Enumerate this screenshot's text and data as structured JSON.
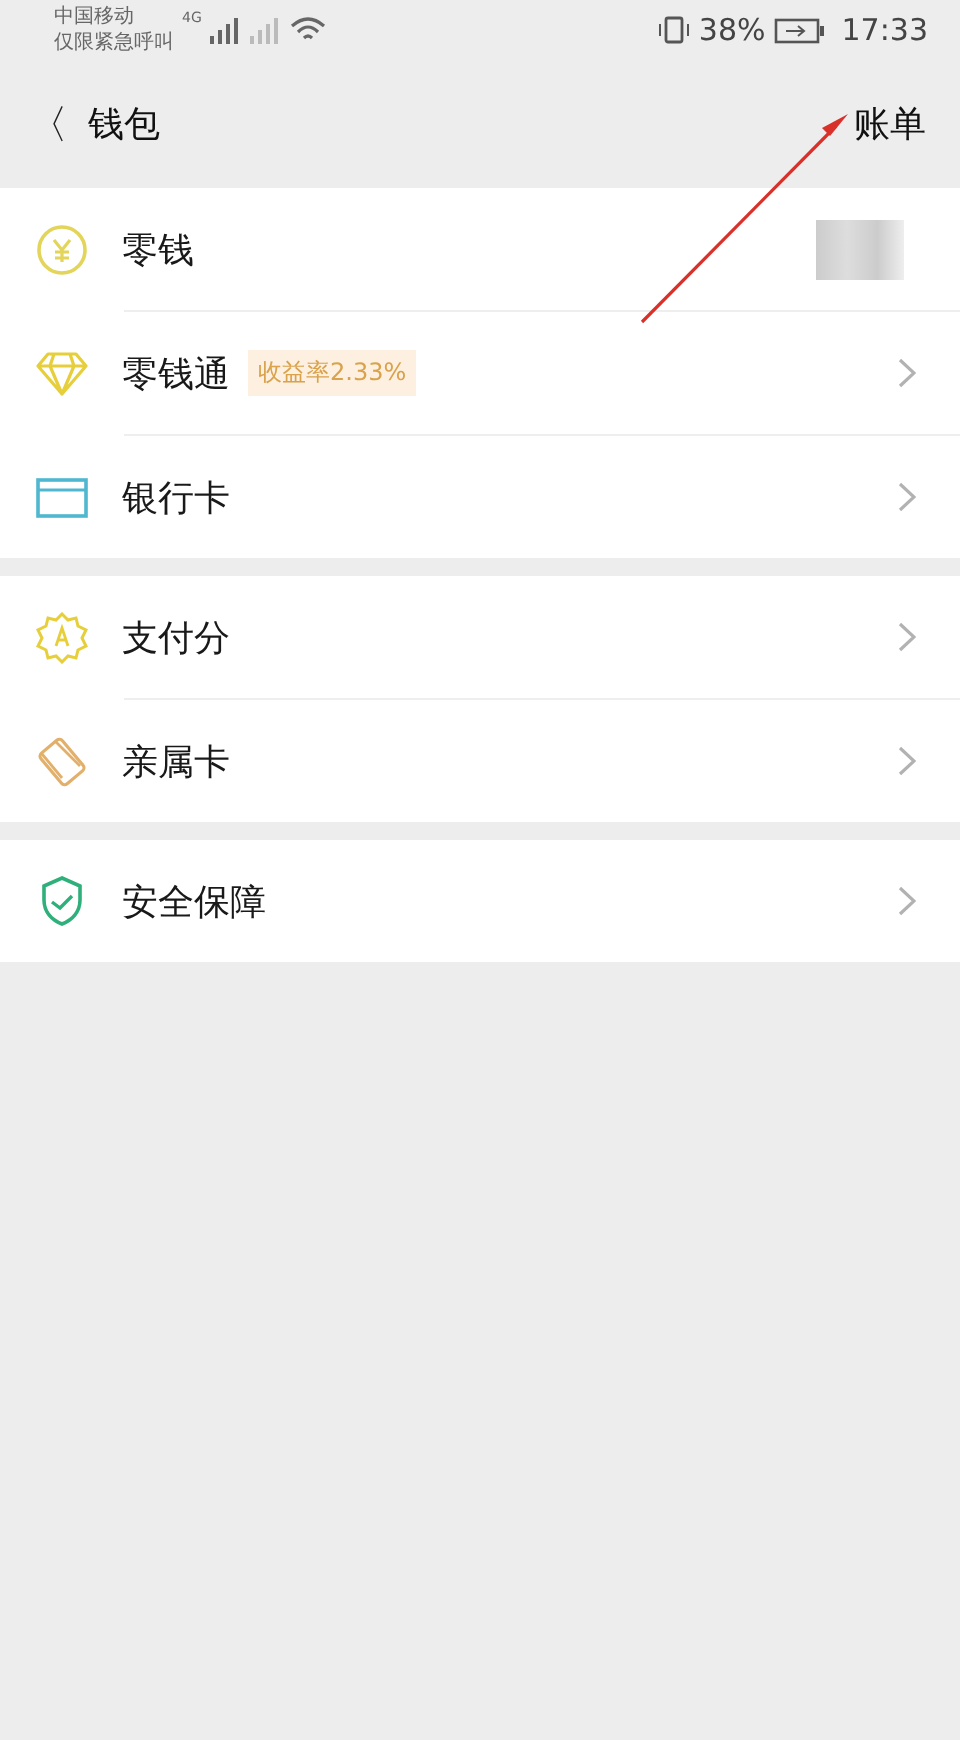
{
  "status_bar": {
    "carrier": "中国移动",
    "carrier_note": "仅限紧急呼叫",
    "network": "4G",
    "battery": "38%",
    "time": "17:33"
  },
  "header": {
    "back": "〈",
    "title": "钱包",
    "action": "账单"
  },
  "groups": [
    {
      "items": [
        {
          "label": "零钱",
          "chevron": false,
          "amount_hidden": true
        },
        {
          "label": "零钱通",
          "badge": "收益率2.33%",
          "chevron": true
        },
        {
          "label": "银行卡",
          "chevron": true
        }
      ]
    },
    {
      "items": [
        {
          "label": "支付分",
          "chevron": true
        },
        {
          "label": "亲属卡",
          "chevron": true
        }
      ]
    },
    {
      "items": [
        {
          "label": "安全保障",
          "chevron": true
        }
      ]
    }
  ]
}
